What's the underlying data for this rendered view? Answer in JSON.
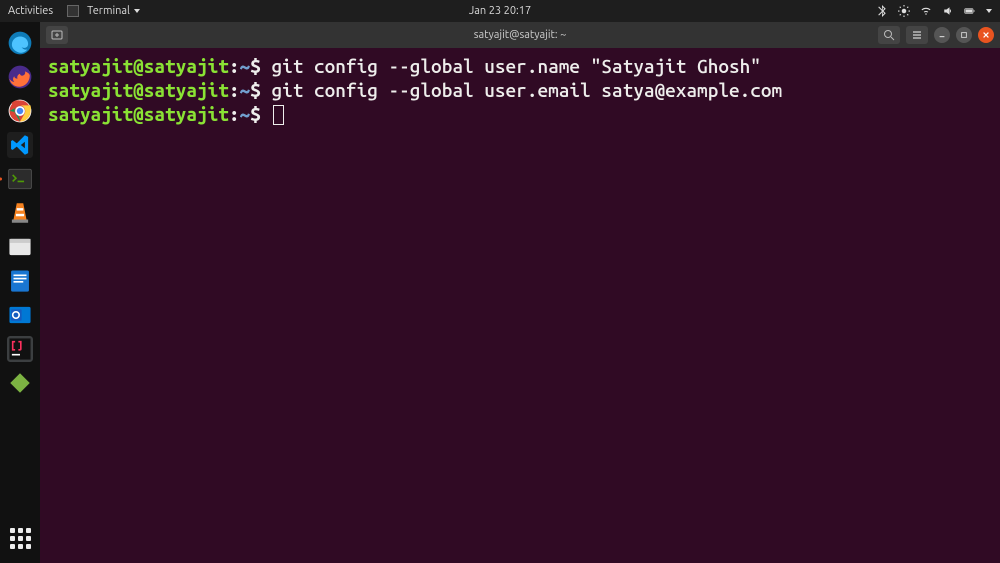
{
  "topbar": {
    "activities": "Activities",
    "app_menu": "Terminal",
    "datetime": "Jan 23  20:17"
  },
  "dock": {
    "items": [
      {
        "name": "edge",
        "bg": "#0e7bb8"
      },
      {
        "name": "firefox",
        "bg": "#ff7139"
      },
      {
        "name": "chrome",
        "bg": "#fff"
      },
      {
        "name": "vscode",
        "bg": "#1e1e1e"
      },
      {
        "name": "terminal",
        "bg": "#2c2c2c"
      },
      {
        "name": "vlc",
        "bg": "#f58220"
      },
      {
        "name": "files",
        "bg": "#e8e8e8"
      },
      {
        "name": "libreoffice-writer",
        "bg": "#1976d2"
      },
      {
        "name": "outlook",
        "bg": "#0078d4"
      },
      {
        "name": "intellij",
        "bg": "#3c3f41"
      },
      {
        "name": "snap",
        "bg": "#7cb342"
      }
    ]
  },
  "terminal": {
    "title": "satyajit@satyajit: ~",
    "lines": [
      {
        "userhost": "satyajit@satyajit",
        "path": "~",
        "command": "git config --global user.name \"Satyajit Ghosh\""
      },
      {
        "userhost": "satyajit@satyajit",
        "path": "~",
        "command": "git config --global user.email satya@example.com"
      },
      {
        "userhost": "satyajit@satyajit",
        "path": "~",
        "command": ""
      }
    ],
    "dollar": "$"
  }
}
